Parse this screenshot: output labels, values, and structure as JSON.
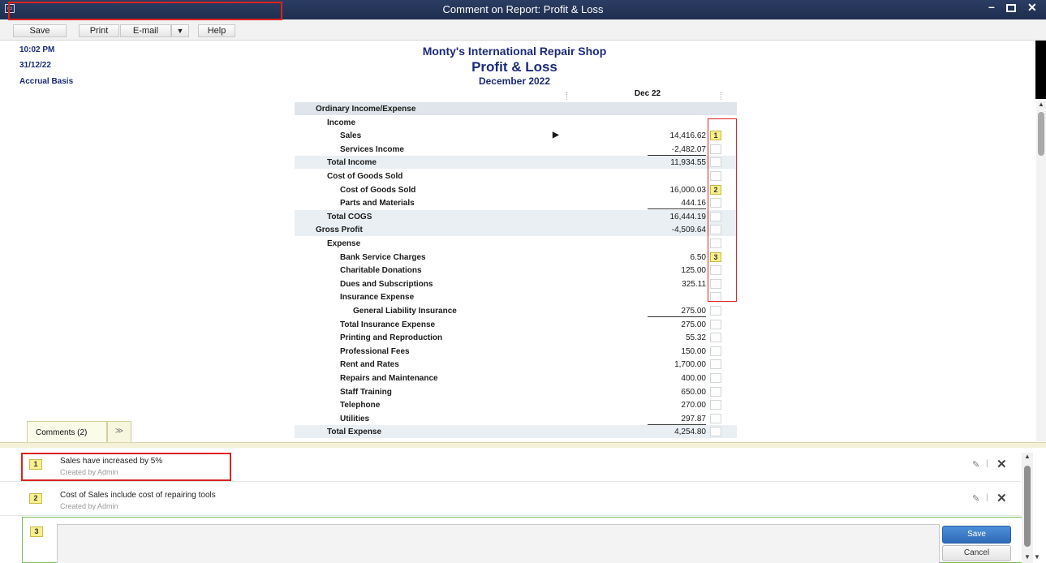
{
  "window": {
    "title": "Comment on Report: Profit & Loss"
  },
  "toolbar": {
    "save": "Save",
    "print": "Print",
    "email": "E-mail",
    "email_dropdown": "▼",
    "help": "Help"
  },
  "meta": {
    "time": "10:02 PM",
    "date": "31/12/22",
    "basis": "Accrual Basis"
  },
  "report": {
    "company": "Monty's International Repair Shop",
    "title": "Profit & Loss",
    "period": "December 2022",
    "column": "Dec 22",
    "rows": [
      {
        "label": "Ordinary Income/Expense",
        "amount": "",
        "comment": ""
      },
      {
        "label": "Income",
        "amount": "",
        "comment": ""
      },
      {
        "label": "Sales",
        "amount": "14,416.62",
        "comment": "1"
      },
      {
        "label": "Services Income",
        "amount": "-2,482.07",
        "comment": ""
      },
      {
        "label": "Total Income",
        "amount": "11,934.55",
        "comment": ""
      },
      {
        "label": "Cost of Goods Sold",
        "amount": "",
        "comment": ""
      },
      {
        "label": "Cost of Goods Sold",
        "amount": "16,000.03",
        "comment": "2"
      },
      {
        "label": "Parts and Materials",
        "amount": "444.16",
        "comment": ""
      },
      {
        "label": "Total COGS",
        "amount": "16,444.19",
        "comment": ""
      },
      {
        "label": "Gross Profit",
        "amount": "-4,509.64",
        "comment": ""
      },
      {
        "label": "Expense",
        "amount": "",
        "comment": ""
      },
      {
        "label": "Bank Service Charges",
        "amount": "6.50",
        "comment": "3"
      },
      {
        "label": "Charitable Donations",
        "amount": "125.00",
        "comment": ""
      },
      {
        "label": "Dues and Subscriptions",
        "amount": "325.11",
        "comment": ""
      },
      {
        "label": "Insurance Expense",
        "amount": "",
        "comment": ""
      },
      {
        "label": "General Liability Insurance",
        "amount": "275.00",
        "comment": ""
      },
      {
        "label": "Total Insurance Expense",
        "amount": "275.00",
        "comment": ""
      },
      {
        "label": "Printing and Reproduction",
        "amount": "55.32",
        "comment": ""
      },
      {
        "label": "Professional Fees",
        "amount": "150.00",
        "comment": ""
      },
      {
        "label": "Rent and Rates",
        "amount": "1,700.00",
        "comment": ""
      },
      {
        "label": "Repairs and Maintenance",
        "amount": "400.00",
        "comment": ""
      },
      {
        "label": "Staff Training",
        "amount": "650.00",
        "comment": ""
      },
      {
        "label": "Telephone",
        "amount": "270.00",
        "comment": ""
      },
      {
        "label": "Utilities",
        "amount": "297.87",
        "comment": ""
      },
      {
        "label": "Total Expense",
        "amount": "4,254.80",
        "comment": ""
      }
    ]
  },
  "comments": {
    "tab_label": "Comments (2)",
    "collapse_glyph": "≫",
    "items": [
      {
        "number": "1",
        "text": "Sales have increased by 5%",
        "by": "Created by Admin"
      },
      {
        "number": "2",
        "text": "Cost of Sales include cost of repairing tools",
        "by": "Created by Admin"
      }
    ],
    "new_number": "3",
    "save_label": "Save",
    "cancel_label": "Cancel"
  }
}
